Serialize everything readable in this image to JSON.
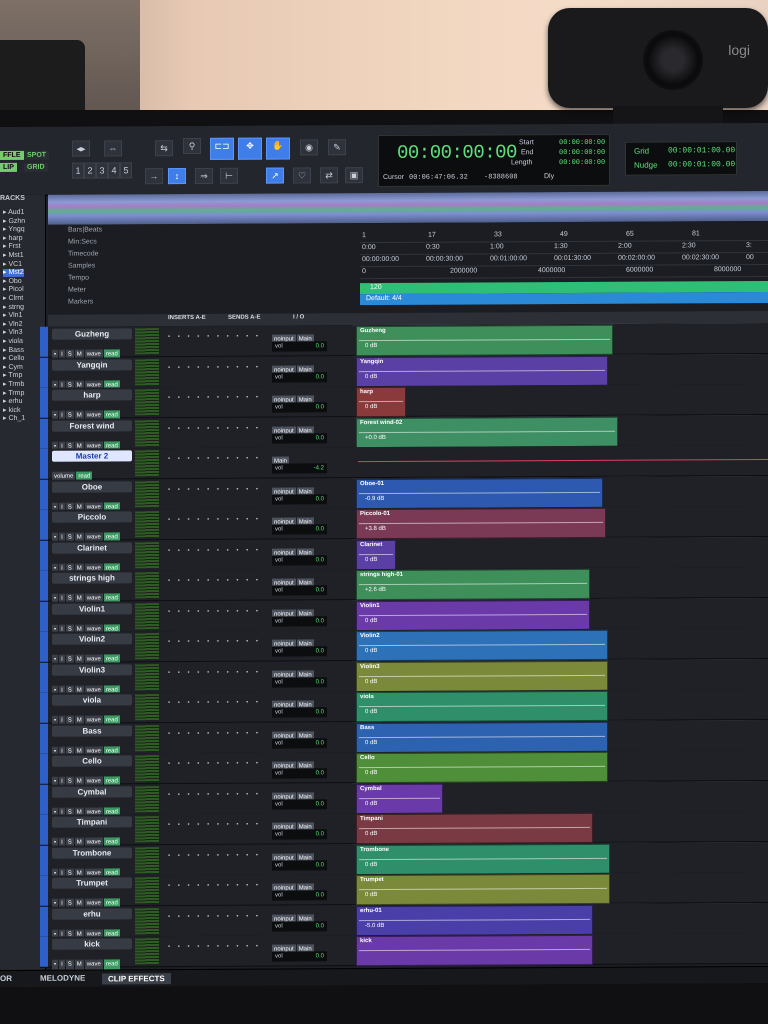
{
  "camera": {
    "brand": "logi"
  },
  "toolbar": {
    "mode_shuffle": "FFLE",
    "mode_spot": "SPOT",
    "mode_slip": "LIP",
    "mode_grid": "GRID",
    "counter_main": "00:00:00:00",
    "start_label": "Start",
    "end_label": "End",
    "length_label": "Length",
    "start_val": "00:00:00:00",
    "end_val": "00:00:00:00",
    "length_val": "00:00:00:00",
    "cursor_label": "Cursor",
    "cursor_val": "00:06:47:06.32",
    "cursor_sample": "-8388608",
    "dly_label": "Dly",
    "grid_label": "Grid",
    "grid_val": "00:00:01:00.00",
    "nudge_label": "Nudge",
    "nudge_val": "00:00:01:00.00",
    "count_buttons": [
      "1",
      "2",
      "3",
      "4",
      "5"
    ]
  },
  "tracklist": {
    "header": "RACKS",
    "items": [
      "Aud1",
      "Gzhn",
      "Yngq",
      "harp",
      "Frst",
      "Mst1",
      "VC1",
      "Mst2",
      "Obo",
      "Picol",
      "Clrnt",
      "strng",
      "Vln1",
      "Vln2",
      "Vln3",
      "viola",
      "Bass",
      "Cello",
      "Cym",
      "Tmp",
      "Trmb",
      "Trmp",
      "erhu",
      "kick",
      "Ch_1"
    ],
    "selected": "Mst2"
  },
  "rulers": {
    "labels": [
      "Bars|Beats",
      "Min:Secs",
      "Timecode",
      "Samples",
      "Tempo",
      "Meter",
      "Markers"
    ],
    "bars": [
      "1",
      "17",
      "33",
      "49",
      "65",
      "81"
    ],
    "minsecs": [
      "0:00",
      "0:30",
      "1:00",
      "1:30",
      "2:00",
      "2:30",
      "3:"
    ],
    "timecode": [
      "00:00:00:00",
      "00:00:30:00",
      "00:01:00:00",
      "00:01:30:00",
      "00:02:00:00",
      "00:02:30:00",
      "00"
    ],
    "samples": [
      "0",
      "2000000",
      "4000000",
      "6000000",
      "8000000"
    ],
    "tempo": "120",
    "meter": "Default: 4/4"
  },
  "columns": {
    "inserts": "INSERTS A-E",
    "sends": "SENDS A-E",
    "io": "I / O"
  },
  "tracks": [
    {
      "name": "Guzheng",
      "out": "Main",
      "vol": "0.0",
      "clip": "Guzheng",
      "gain": "0 dB",
      "color": "#3e8f5a",
      "len": 255
    },
    {
      "name": "Yangqin",
      "out": "Main",
      "vol": "0.0",
      "clip": "Yangqin",
      "gain": "0 dB",
      "color": "#5a3fa4",
      "len": 250
    },
    {
      "name": "harp",
      "out": "Main",
      "vol": "0.0",
      "clip": "harp",
      "gain": "0 dB",
      "color": "#8a3a3a",
      "len": 48
    },
    {
      "name": "Forest wind",
      "out": "Main",
      "vol": "0.0",
      "clip": "Forest wind-02",
      "gain": "+0.0 dB",
      "color": "#3f8f65",
      "len": 260
    },
    {
      "name": "Master 2",
      "out": "Main",
      "vol": "-4.2",
      "clip": "",
      "gain": "",
      "color": "",
      "len": 0,
      "master": true
    },
    {
      "name": "Oboe",
      "out": "Main",
      "vol": "0.0",
      "clip": "Oboe-01",
      "gain": "-0.9 dB",
      "color": "#2d5ab0",
      "len": 245
    },
    {
      "name": "Piccolo",
      "out": "Main",
      "vol": "0.0",
      "clip": "Piccolo-01",
      "gain": "+3.8 dB",
      "color": "#7a3a55",
      "len": 248
    },
    {
      "name": "Clarinet",
      "out": "Main",
      "vol": "0.0",
      "clip": "Clarinet",
      "gain": "0 dB",
      "color": "#5a3fa4",
      "len": 38
    },
    {
      "name": "strings high",
      "out": "Main",
      "vol": "0.0",
      "clip": "strings high-01",
      "gain": "+2.6 dB",
      "color": "#3e8f5a",
      "len": 232
    },
    {
      "name": "Violin1",
      "out": "Main",
      "vol": "0.0",
      "clip": "Violin1",
      "gain": "0 dB",
      "color": "#6a3aa8",
      "len": 232
    },
    {
      "name": "Violin2",
      "out": "Main",
      "vol": "0.0",
      "clip": "Violin2",
      "gain": "0 dB",
      "color": "#2d72b8",
      "len": 250
    },
    {
      "name": "Violin3",
      "out": "Main",
      "vol": "0.0",
      "clip": "Violin3",
      "gain": "0 dB",
      "color": "#7b8a3a",
      "len": 250
    },
    {
      "name": "viola",
      "out": "Main",
      "vol": "0.0",
      "clip": "viola",
      "gain": "0 dB",
      "color": "#2f8f6a",
      "len": 250
    },
    {
      "name": "Bass",
      "out": "Main",
      "vol": "0.0",
      "clip": "Bass",
      "gain": "0 dB",
      "color": "#2d62b0",
      "len": 250
    },
    {
      "name": "Cello",
      "out": "Main",
      "vol": "0.0",
      "clip": "Cello",
      "gain": "0 dB",
      "color": "#4f8f3a",
      "len": 250
    },
    {
      "name": "Cymbal",
      "out": "Main",
      "vol": "0.0",
      "clip": "Cymbal",
      "gain": "0 dB",
      "color": "#6a3aa8",
      "len": 85
    },
    {
      "name": "Timpani",
      "out": "Main",
      "vol": "0.0",
      "clip": "Timpani",
      "gain": "0 dB",
      "color": "#7a3a44",
      "len": 235
    },
    {
      "name": "Trombone",
      "out": "Main",
      "vol": "0.0",
      "clip": "Trombone",
      "gain": "0 dB",
      "color": "#2f8f6a",
      "len": 252
    },
    {
      "name": "Trumpet",
      "out": "Main",
      "vol": "0.0",
      "clip": "Trumpet",
      "gain": "0 dB",
      "color": "#7b8a3a",
      "len": 252
    },
    {
      "name": "erhu",
      "out": "Main",
      "vol": "0.0",
      "clip": "erhu-01",
      "gain": "-5.0 dB",
      "color": "#4a3fa8",
      "len": 235
    },
    {
      "name": "kick",
      "out": "Main",
      "vol": "0.0",
      "clip": "kick",
      "gain": "",
      "color": "#6a3aa8",
      "len": 235
    }
  ],
  "track_strings": {
    "btns": [
      "•",
      "I",
      "S",
      "M"
    ],
    "wave": "wave",
    "read": "read",
    "input": "noinput",
    "vol_label": "vol",
    "volume": "volume"
  },
  "bottom_tabs": {
    "tab1": "OR",
    "tab2": "MELODYNE",
    "tab3": "CLIP EFFECTS"
  }
}
